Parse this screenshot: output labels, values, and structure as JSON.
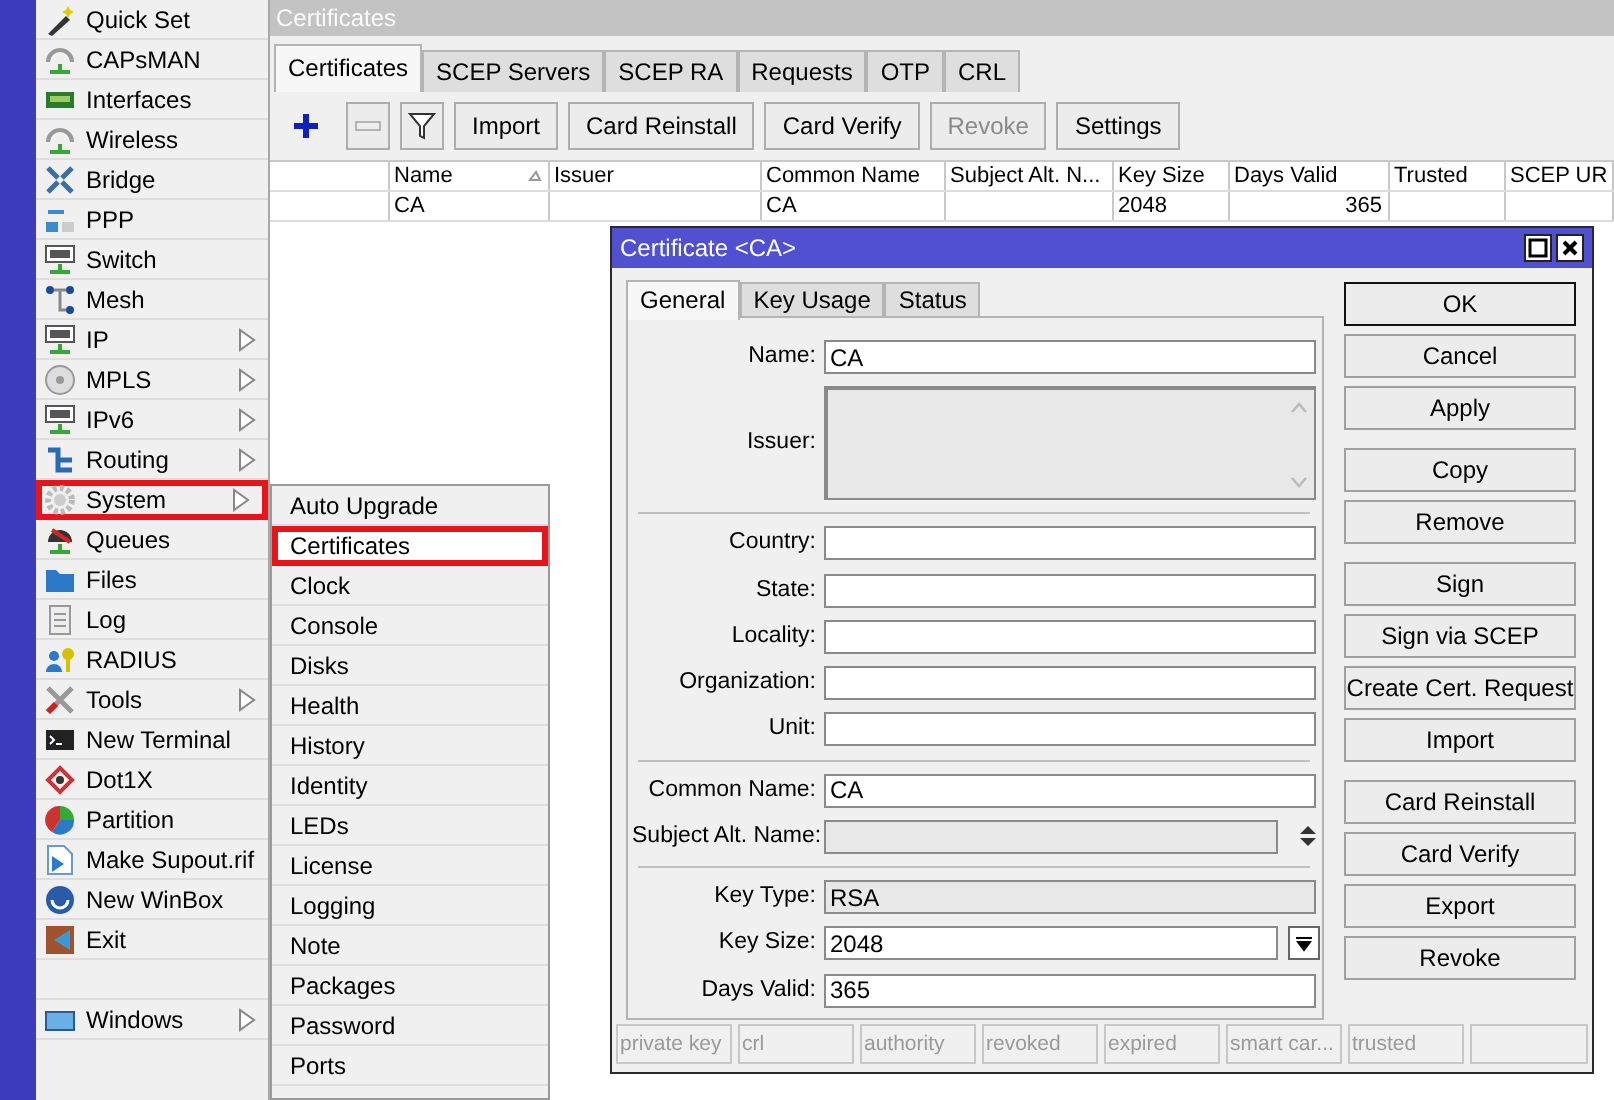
{
  "sidebar": {
    "items": [
      {
        "label": "Quick Set",
        "has_submenu": false,
        "highlighted": false
      },
      {
        "label": "CAPsMAN",
        "has_submenu": false,
        "highlighted": false
      },
      {
        "label": "Interfaces",
        "has_submenu": false,
        "highlighted": false
      },
      {
        "label": "Wireless",
        "has_submenu": false,
        "highlighted": false
      },
      {
        "label": "Bridge",
        "has_submenu": false,
        "highlighted": false
      },
      {
        "label": "PPP",
        "has_submenu": false,
        "highlighted": false
      },
      {
        "label": "Switch",
        "has_submenu": false,
        "highlighted": false
      },
      {
        "label": "Mesh",
        "has_submenu": false,
        "highlighted": false
      },
      {
        "label": "IP",
        "has_submenu": true,
        "highlighted": false
      },
      {
        "label": "MPLS",
        "has_submenu": true,
        "highlighted": false
      },
      {
        "label": "IPv6",
        "has_submenu": true,
        "highlighted": false
      },
      {
        "label": "Routing",
        "has_submenu": true,
        "highlighted": false
      },
      {
        "label": "System",
        "has_submenu": true,
        "highlighted": true
      },
      {
        "label": "Queues",
        "has_submenu": false,
        "highlighted": false
      },
      {
        "label": "Files",
        "has_submenu": false,
        "highlighted": false
      },
      {
        "label": "Log",
        "has_submenu": false,
        "highlighted": false
      },
      {
        "label": "RADIUS",
        "has_submenu": false,
        "highlighted": false
      },
      {
        "label": "Tools",
        "has_submenu": true,
        "highlighted": false
      },
      {
        "label": "New Terminal",
        "has_submenu": false,
        "highlighted": false
      },
      {
        "label": "Dot1X",
        "has_submenu": false,
        "highlighted": false
      },
      {
        "label": "Partition",
        "has_submenu": false,
        "highlighted": false
      },
      {
        "label": "Make Supout.rif",
        "has_submenu": false,
        "highlighted": false
      },
      {
        "label": "New WinBox",
        "has_submenu": false,
        "highlighted": false
      },
      {
        "label": "Exit",
        "has_submenu": false,
        "highlighted": false
      }
    ],
    "bottom_items": [
      {
        "label": "Windows",
        "has_submenu": true,
        "highlighted": false
      }
    ]
  },
  "submenu": {
    "items": [
      {
        "label": "Auto Upgrade",
        "selected": false,
        "highlighted": false
      },
      {
        "label": "Certificates",
        "selected": true,
        "highlighted": true
      },
      {
        "label": "Clock",
        "selected": false,
        "highlighted": false
      },
      {
        "label": "Console",
        "selected": false,
        "highlighted": false
      },
      {
        "label": "Disks",
        "selected": false,
        "highlighted": false
      },
      {
        "label": "Health",
        "selected": false,
        "highlighted": false
      },
      {
        "label": "History",
        "selected": false,
        "highlighted": false
      },
      {
        "label": "Identity",
        "selected": false,
        "highlighted": false
      },
      {
        "label": "LEDs",
        "selected": false,
        "highlighted": false
      },
      {
        "label": "License",
        "selected": false,
        "highlighted": false
      },
      {
        "label": "Logging",
        "selected": false,
        "highlighted": false
      },
      {
        "label": "Note",
        "selected": false,
        "highlighted": false
      },
      {
        "label": "Packages",
        "selected": false,
        "highlighted": false
      },
      {
        "label": "Password",
        "selected": false,
        "highlighted": false
      },
      {
        "label": "Ports",
        "selected": false,
        "highlighted": false
      }
    ]
  },
  "window": {
    "title": "Certificates",
    "tabs": [
      {
        "label": "Certificates",
        "selected": true
      },
      {
        "label": "SCEP Servers",
        "selected": false
      },
      {
        "label": "SCEP RA",
        "selected": false
      },
      {
        "label": "Requests",
        "selected": false
      },
      {
        "label": "OTP",
        "selected": false
      },
      {
        "label": "CRL",
        "selected": false
      }
    ],
    "toolbar": [
      {
        "kind": "add",
        "disabled": false,
        "highlighted": true
      },
      {
        "kind": "remove",
        "disabled": true,
        "highlighted": false
      },
      {
        "kind": "filter",
        "disabled": false,
        "highlighted": false
      },
      {
        "kind": "text",
        "label": "Import",
        "disabled": false,
        "highlighted": false
      },
      {
        "kind": "text",
        "label": "Card Reinstall",
        "disabled": false,
        "highlighted": false
      },
      {
        "kind": "text",
        "label": "Card Verify",
        "disabled": false,
        "highlighted": false
      },
      {
        "kind": "text",
        "label": "Revoke",
        "disabled": true,
        "highlighted": false
      },
      {
        "kind": "text",
        "label": "Settings",
        "disabled": false,
        "highlighted": false
      }
    ],
    "table": {
      "columns": [
        {
          "label": "Name",
          "sorted": true
        },
        {
          "label": "Issuer",
          "sorted": false
        },
        {
          "label": "Common Name",
          "sorted": false
        },
        {
          "label": "Subject Alt. N...",
          "sorted": false
        },
        {
          "label": "Key Size",
          "sorted": false
        },
        {
          "label": "Days Valid",
          "sorted": false
        },
        {
          "label": "Trusted",
          "sorted": false
        },
        {
          "label": "SCEP UR",
          "sorted": false
        }
      ],
      "rows": [
        [
          "CA",
          null,
          "CA",
          null,
          "2048",
          "365",
          null,
          null
        ]
      ]
    }
  },
  "dialog": {
    "title": "Certificate <CA>",
    "tabs": [
      {
        "label": "General",
        "selected": true
      },
      {
        "label": "Key Usage",
        "selected": false
      },
      {
        "label": "Status",
        "selected": false
      }
    ],
    "fields": [
      {
        "kind": "text",
        "label": "Name:",
        "value": "CA",
        "disabled": false
      },
      {
        "kind": "textarea",
        "label": "Issuer:",
        "disabled": true
      },
      {
        "kind": "separator"
      },
      {
        "kind": "text",
        "label": "Country:",
        "disabled": false
      },
      {
        "kind": "text",
        "label": "State:",
        "disabled": false
      },
      {
        "kind": "text",
        "label": "Locality:",
        "disabled": false
      },
      {
        "kind": "text",
        "label": "Organization:",
        "disabled": false
      },
      {
        "kind": "text",
        "label": "Unit:",
        "disabled": false
      },
      {
        "kind": "separator"
      },
      {
        "kind": "text",
        "label": "Common Name:",
        "value": "CA",
        "disabled": false
      },
      {
        "kind": "multi",
        "label": "Subject Alt. Name:",
        "disabled": true
      },
      {
        "kind": "separator"
      },
      {
        "kind": "text",
        "label": "Key Type:",
        "value": "RSA",
        "disabled": true
      },
      {
        "kind": "dropdown",
        "label": "Key Size:",
        "value": "2048",
        "disabled": false
      },
      {
        "kind": "text",
        "label": "Days Valid:",
        "value": "365",
        "disabled": false
      }
    ],
    "button_groups": [
      [
        {
          "label": "OK",
          "default": true
        },
        {
          "label": "Cancel",
          "default": false
        },
        {
          "label": "Apply",
          "default": false
        }
      ],
      [
        {
          "label": "Copy",
          "default": false
        },
        {
          "label": "Remove",
          "default": false
        }
      ],
      [
        {
          "label": "Sign",
          "default": false
        },
        {
          "label": "Sign via SCEP",
          "default": false
        },
        {
          "label": "Create Cert. Request",
          "default": false
        },
        {
          "label": "Import",
          "default": false
        }
      ],
      [
        {
          "label": "Card Reinstall",
          "default": false
        },
        {
          "label": "Card Verify",
          "default": false
        },
        {
          "label": "Export",
          "default": false
        },
        {
          "label": "Revoke",
          "default": false
        }
      ]
    ],
    "status_bar": [
      "private key",
      "crl",
      "authority",
      "revoked",
      "expired",
      "smart car...",
      "trusted"
    ]
  }
}
